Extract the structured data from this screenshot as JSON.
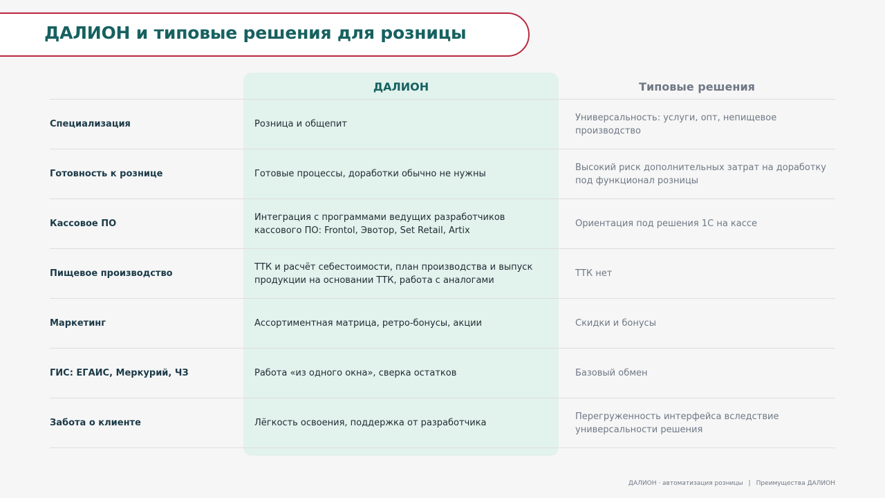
{
  "title": "ДАЛИОН и типовые решения для розницы",
  "columns": {
    "dalion": "ДАЛИОН",
    "typical": "Типовые решения"
  },
  "rows": [
    {
      "label": "Специализация",
      "dalion": "Розница и общепит",
      "typical": "Универсальность: услуги, опт, непищевое производство"
    },
    {
      "label": "Готовность к рознице",
      "dalion": "Готовые процессы, доработки обычно не нужны",
      "typical": "Высокий риск дополнительных затрат на доработку под функционал розницы"
    },
    {
      "label": "Кассовое ПО",
      "dalion": "Интеграция с программами ведущих разработчиков кассового ПО: Frontol, Эвотор, Set Retail, Artix",
      "typical": "Ориентация под решения 1С на кассе"
    },
    {
      "label": "Пищевое производство",
      "dalion": "ТТК и расчёт себестоимости, план производства и выпуск продукции на основании ТТК, работа с аналогами",
      "typical": "ТТК нет"
    },
    {
      "label": "Маркетинг",
      "dalion": "Ассортиментная матрица, ретро-бонусы, акции",
      "typical": "Скидки и бонусы"
    },
    {
      "label": "ГИС: ЕГАИС, Меркурий, ЧЗ",
      "dalion": "Работа «из одного окна», сверка остатков",
      "typical": "Базовый обмен"
    },
    {
      "label": "Забота о клиенте",
      "dalion": "Лёгкость освоения, поддержка от разработчика",
      "typical": "Перегруженность интерфейса вследствие универсальности решения"
    }
  ],
  "footer": {
    "left": "ДАЛИОН · автоматизация розницы",
    "separator": "|",
    "right": "Преимущества ДАЛИОН"
  },
  "colors": {
    "title": "#166160",
    "accent_border": "#b8283f",
    "highlight": "#e2f2ec",
    "muted_text": "#6f7885"
  }
}
